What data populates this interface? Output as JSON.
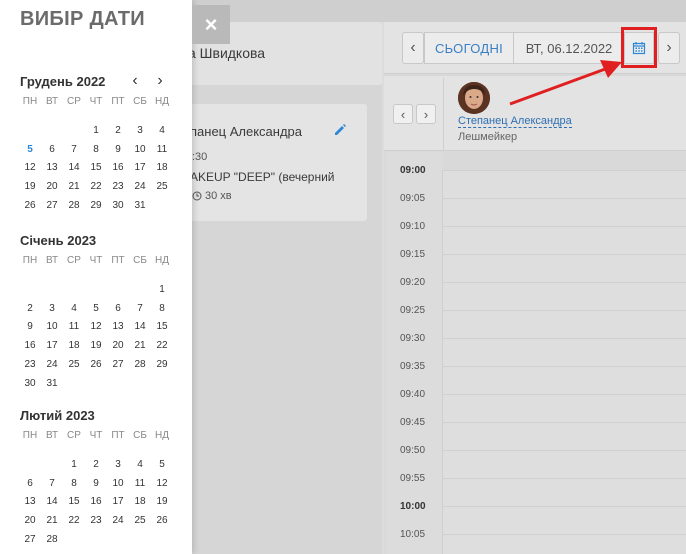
{
  "client": {
    "name": "а Швидкова"
  },
  "appointment": {
    "staff": "панец Александра",
    "time": ":30",
    "service": "AKEUP \"DEEP\" (вечерний",
    "duration": "30 хв"
  },
  "toolbar": {
    "prev": "‹",
    "today": "СЬОГОДНІ",
    "date": "ВТ, 06.12.2022",
    "next": "›"
  },
  "staff": {
    "name": "Степанец Александра",
    "role": "Лешмейкер",
    "prev": "‹",
    "next": "›"
  },
  "times": [
    "09:00",
    "09:05",
    "09:10",
    "09:15",
    "09:20",
    "09:25",
    "09:30",
    "09:35",
    "09:40",
    "09:45",
    "09:50",
    "09:55",
    "10:00",
    "10:05"
  ],
  "bold_times": [
    "09:00",
    "10:00"
  ],
  "picker": {
    "title": "ВИБІР ДАТИ",
    "close": "×",
    "nav_prev": "‹",
    "nav_next": "›",
    "weekdays": [
      "ПН",
      "ВТ",
      "СР",
      "ЧТ",
      "ПТ",
      "СБ",
      "НД"
    ],
    "months": [
      {
        "title": "Грудень 2022",
        "today": "5",
        "weeks": [
          [
            "",
            "",
            "",
            "1",
            "2",
            "3",
            "4"
          ],
          [
            "5",
            "6",
            "7",
            "8",
            "9",
            "10",
            "11"
          ],
          [
            "12",
            "13",
            "14",
            "15",
            "16",
            "17",
            "18"
          ],
          [
            "19",
            "20",
            "21",
            "22",
            "23",
            "24",
            "25"
          ],
          [
            "26",
            "27",
            "28",
            "29",
            "30",
            "31",
            ""
          ]
        ]
      },
      {
        "title": "Січень 2023",
        "today": "",
        "weeks": [
          [
            "",
            "",
            "",
            "",
            "",
            "",
            "1"
          ],
          [
            "2",
            "3",
            "4",
            "5",
            "6",
            "7",
            "8"
          ],
          [
            "9",
            "10",
            "11",
            "12",
            "13",
            "14",
            "15"
          ],
          [
            "16",
            "17",
            "18",
            "19",
            "20",
            "21",
            "22"
          ],
          [
            "23",
            "24",
            "25",
            "26",
            "27",
            "28",
            "29"
          ],
          [
            "30",
            "31",
            "",
            "",
            "",
            "",
            ""
          ]
        ]
      },
      {
        "title": "Лютий 2023",
        "today": "",
        "weeks": [
          [
            "",
            "",
            "1",
            "2",
            "3",
            "4",
            "5"
          ],
          [
            "6",
            "7",
            "8",
            "9",
            "10",
            "11",
            "12"
          ],
          [
            "13",
            "14",
            "15",
            "16",
            "17",
            "18",
            "19"
          ],
          [
            "20",
            "21",
            "22",
            "23",
            "24",
            "25",
            "26"
          ],
          [
            "27",
            "28",
            "",
            "",
            "",
            "",
            ""
          ]
        ]
      }
    ]
  }
}
